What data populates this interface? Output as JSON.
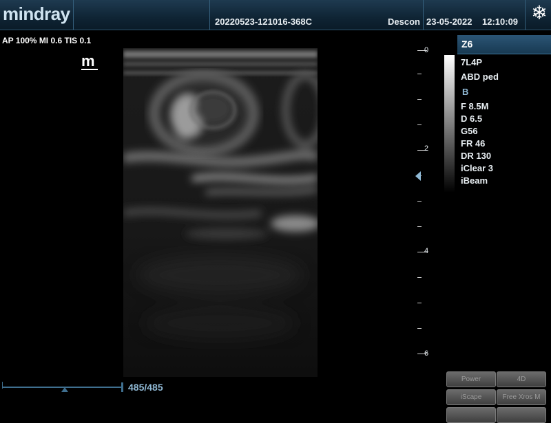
{
  "header": {
    "brand": "mindray",
    "exam_id": "20220523-121016-368C",
    "hospital": "Descon",
    "date": "23-05-2022",
    "time": "12:10:09",
    "freeze_icon": "snowflake-icon"
  },
  "acoustic_output": "AP 100%  MI 0.6  TIS 0.1",
  "mode_badge": "m",
  "depth_scale": {
    "labels": [
      "0",
      "2",
      "4",
      "6"
    ],
    "unit": "cm"
  },
  "right_panel": {
    "tab": "Z6",
    "probe": "7L4P",
    "preset": "ABD ped",
    "mode": "B",
    "params": [
      "F 8.5M",
      "D 6.5",
      "G56",
      "FR 46",
      "DR 130",
      "iClear 3",
      "iBeam"
    ]
  },
  "cine": {
    "frame_counter": "485/485",
    "position": 1.0
  },
  "softkeys": [
    "Power",
    "4D",
    "iScape",
    "Free Xros M"
  ],
  "colors": {
    "header_bg": "#0f2434",
    "accent": "#8fb8d4",
    "tab_bg": "#1f4766"
  }
}
